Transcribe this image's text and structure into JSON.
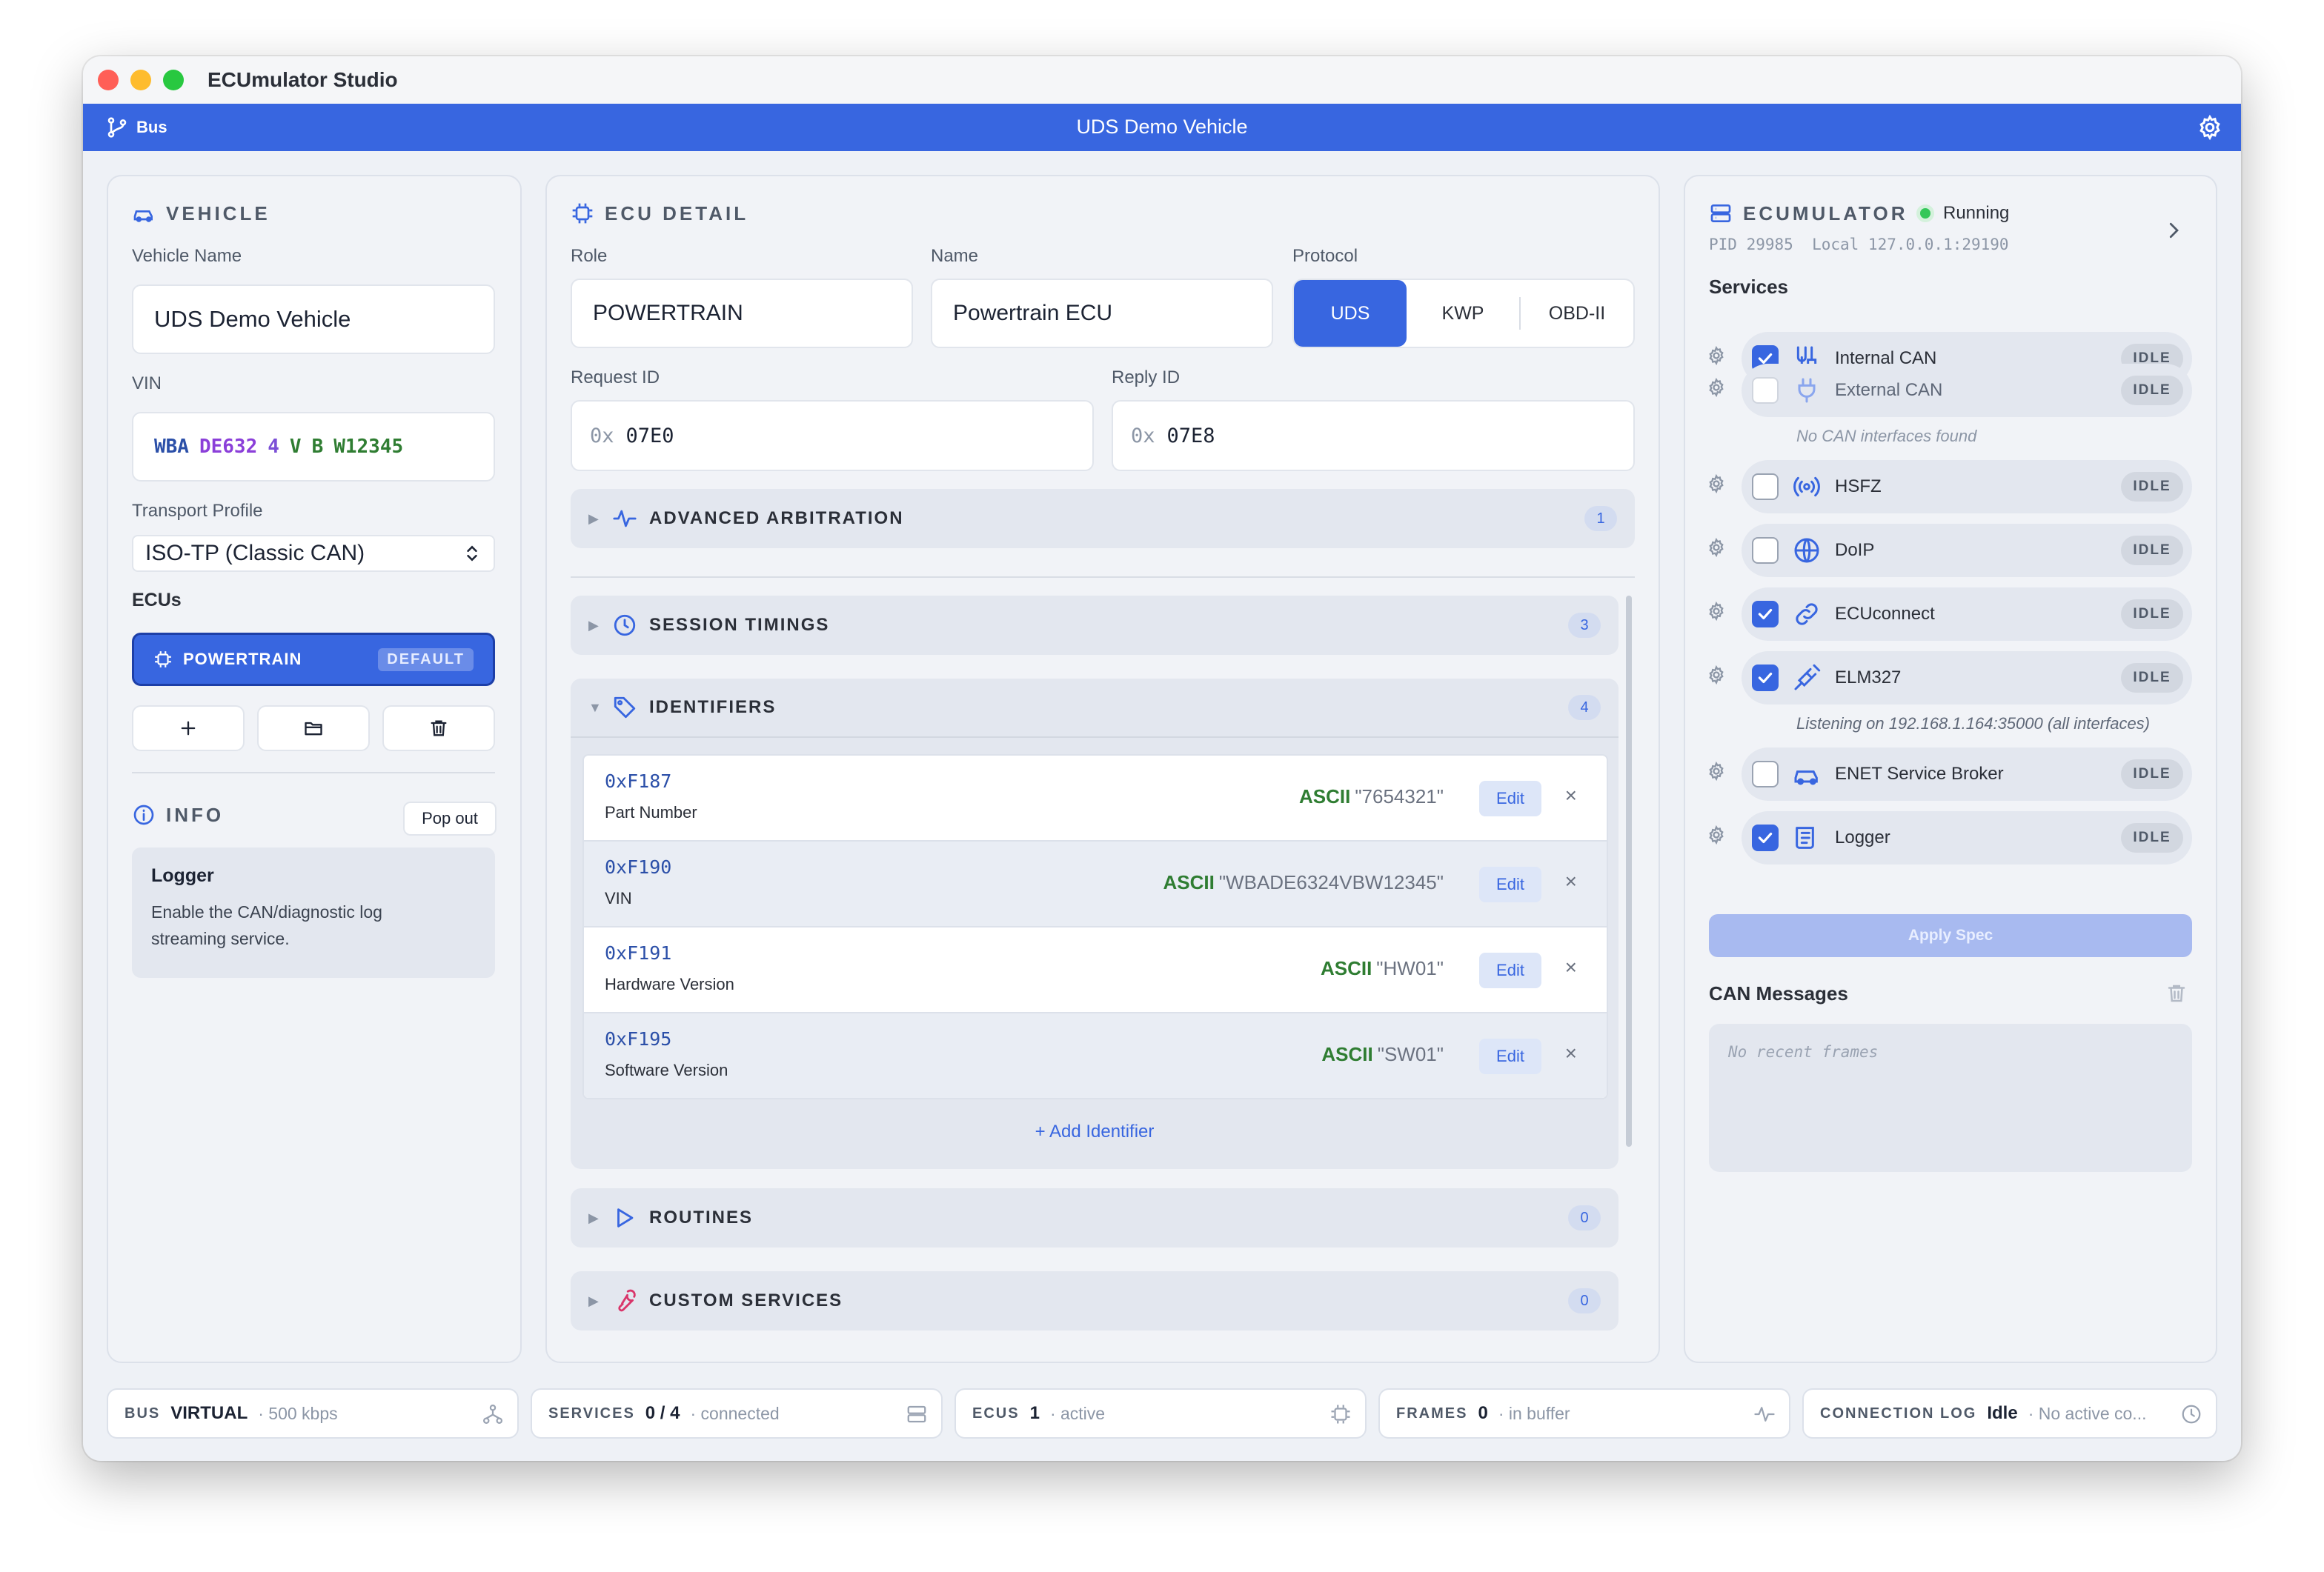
{
  "app": {
    "title": "ECUmulator Studio"
  },
  "topbar": {
    "bus_label": "Bus",
    "vehicle_title": "UDS Demo Vehicle"
  },
  "vehicle": {
    "section_title": "VEHICLE",
    "name_label": "Vehicle Name",
    "name_value": "UDS Demo Vehicle",
    "vin_label": "VIN",
    "vin_parts": [
      "WBA",
      "DE632",
      "4",
      "V",
      "B",
      "W12345"
    ],
    "transport_label": "Transport Profile",
    "transport_value": "ISO-TP (Classic CAN)",
    "ecus_label": "ECUs",
    "ecu_item": {
      "label": "POWERTRAIN",
      "badge": "DEFAULT"
    }
  },
  "info": {
    "section_title": "INFO",
    "popout_label": "Pop out",
    "title": "Logger",
    "body": "Enable the CAN/diagnostic log streaming service."
  },
  "ecu_detail": {
    "section_title": "ECU DETAIL",
    "role_label": "Role",
    "role_value": "POWERTRAIN",
    "name_label": "Name",
    "name_value": "Powertrain ECU",
    "protocol_label": "Protocol",
    "protocols": [
      "UDS",
      "KWP",
      "OBD-II"
    ],
    "protocol_selected": "UDS",
    "request_label": "Request ID",
    "request_prefix": "0x",
    "request_value": "07E0",
    "reply_label": "Reply ID",
    "reply_prefix": "0x",
    "reply_value": "07E8",
    "advanced": {
      "title": "ADVANCED ARBITRATION",
      "count": "1"
    },
    "session": {
      "title": "SESSION TIMINGS",
      "count": "3"
    },
    "identifiers": {
      "title": "IDENTIFIERS",
      "count": "4",
      "rows": [
        {
          "id": "0xF187",
          "name": "Part Number",
          "encoding": "ASCII",
          "value": "\"7654321\"",
          "edit": "Edit"
        },
        {
          "id": "0xF190",
          "name": "VIN",
          "encoding": "ASCII",
          "value": "\"WBADE6324VBW12345\"",
          "edit": "Edit"
        },
        {
          "id": "0xF191",
          "name": "Hardware Version",
          "encoding": "ASCII",
          "value": "\"HW01\"",
          "edit": "Edit"
        },
        {
          "id": "0xF195",
          "name": "Software Version",
          "encoding": "ASCII",
          "value": "\"SW01\"",
          "edit": "Edit"
        }
      ],
      "add_label": "+ Add Identifier"
    },
    "routines": {
      "title": "ROUTINES",
      "count": "0"
    },
    "custom": {
      "title": "CUSTOM SERVICES",
      "count": "0"
    }
  },
  "ecumulator": {
    "section_title": "ECUMULATOR",
    "status": "Running",
    "pid_line": "PID 29985  Local 127.0.0.1:29190",
    "services_label": "Services",
    "services": [
      {
        "name": "Internal CAN",
        "checked": true,
        "icon": "can-bus-icon",
        "status": "IDLE"
      },
      {
        "name": "External CAN",
        "checked": false,
        "icon": "plug-icon",
        "status": "IDLE"
      },
      {
        "name": "HSFZ",
        "checked": false,
        "icon": "broadcast-icon",
        "status": "IDLE"
      },
      {
        "name": "DoIP",
        "checked": false,
        "icon": "globe-icon",
        "status": "IDLE"
      },
      {
        "name": "ECUconnect",
        "checked": true,
        "icon": "link-icon",
        "status": "IDLE"
      },
      {
        "name": "ELM327",
        "checked": true,
        "icon": "cable-icon",
        "status": "IDLE"
      },
      {
        "name": "ENET Service Broker",
        "checked": false,
        "icon": "car-icon",
        "status": "IDLE"
      },
      {
        "name": "Logger",
        "checked": true,
        "icon": "log-icon",
        "status": "IDLE"
      }
    ],
    "external_note": "No CAN interfaces found",
    "elm_note": "Listening on 192.168.1.164:35000 (all interfaces)",
    "apply_label": "Apply Spec",
    "can_messages_label": "CAN Messages",
    "no_frames": "No recent frames"
  },
  "statusbar": {
    "bus": {
      "key": "BUS",
      "value": "VIRTUAL",
      "sub": "500 kbps"
    },
    "services": {
      "key": "SERVICES",
      "value": "0 / 4",
      "sub": "connected"
    },
    "ecus": {
      "key": "ECUS",
      "value": "1",
      "sub": "active"
    },
    "frames": {
      "key": "FRAMES",
      "value": "0",
      "sub": "in buffer"
    },
    "conn": {
      "key": "CONNECTION LOG",
      "value": "Idle",
      "sub": "No active co..."
    }
  },
  "colors": {
    "accent": "#3866e0",
    "running": "#34c759",
    "ascii": "#2f7d32",
    "vin_wmi": "#2b4fa8",
    "vin_vds": "#8b3fd9",
    "vin_check": "#7b4fd6",
    "vin_year": "#2f7d32",
    "vin_plant": "#2f7d32",
    "vin_serial": "#2f7d32"
  }
}
